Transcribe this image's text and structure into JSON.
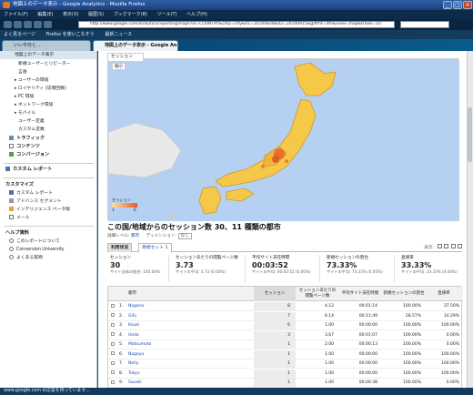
{
  "window": {
    "title": "地図上のデータ表示 - Google Analytics - Mozilla Firefox"
  },
  "menu": [
    "ファイル(F)",
    "編集(E)",
    "表示(V)",
    "履歴(S)",
    "ブックマーク(B)",
    "ツール(T)",
    "ヘルプ(H)"
  ],
  "url": "http://www.google.com/analytics/reporting/maps?id=COUNTRY&cmp=city&d1=20100828&d2=20100915&gdfmt=nth&view=map&trows=10",
  "bookmarks": [
    "よく見るページ",
    "Firefox を使いこなそう",
    "最新ニュース"
  ],
  "tabs": [
    "いい今日と...",
    "地図上のデータ表示 - Google An..."
  ],
  "sidebar": {
    "items": [
      {
        "label": "地図上のデータ表示",
        "type": "selected"
      },
      {
        "label": "新規ユーザーとリピーター",
        "type": "sub"
      },
      {
        "label": "言語",
        "type": "sub"
      },
      {
        "label": "▸ ユーザーの環境",
        "type": "sub"
      },
      {
        "label": "▸ ロイヤリティ (訪問回数)",
        "type": "sub"
      },
      {
        "label": "▸ PC 環境",
        "type": "sub"
      },
      {
        "label": "▸ ネットワーク環境",
        "type": "sub"
      },
      {
        "label": "▸ モバイル",
        "type": "sub"
      },
      {
        "label": "ユーザー定義",
        "type": "sub"
      },
      {
        "label": "カスタム変数",
        "type": "sub"
      },
      {
        "label": "トラフィック",
        "type": "head"
      },
      {
        "label": "コンテンツ",
        "type": "head"
      },
      {
        "label": "コンバージョン",
        "type": "head"
      }
    ],
    "custom_report": "カスタム レポート",
    "customize_title": "カスタマイズ",
    "customize_items": [
      "カスタム レポート",
      "アドバンス セグメント",
      "インテリジェンス ベータ版",
      "メール"
    ],
    "help_title": "ヘルプ資料",
    "help_items": [
      "このレポートについて",
      "Conversion University",
      "よくある質問"
    ]
  },
  "main": {
    "map_tab": "セッション",
    "map_zoom": "縮小",
    "legend_min": "1",
    "legend_max": "6",
    "legend_title": "セッション",
    "heading": "この国/地域からのセッション数 30、11 種類の都市",
    "detail_label": "詳細レベル:",
    "detail_value": "都市",
    "segment_label": "ディメンション:",
    "segment_value": "なし",
    "view_tabs": [
      "利用状況",
      "目標セット 1"
    ],
    "display_label": "表示:"
  },
  "summary": [
    {
      "label": "セッション",
      "value": "30",
      "sub": "サイト全体の割合: 100.00%"
    },
    {
      "label": "セッションあたりの閲覧ページ数",
      "value": "3.73",
      "sub": "サイトの平均: 3.73 (0.00%)"
    },
    {
      "label": "平均サイト滞在時間",
      "value": "00:03:52",
      "sub": "サイトの平均: 00:03:52 (0.00%)"
    },
    {
      "label": "新規セッションの割合",
      "value": "73.33%",
      "sub": "サイトの平均: 73.33% (0.00%)"
    },
    {
      "label": "直帰率",
      "value": "33.33%",
      "sub": "サイトの平均: 33.33% (0.00%)"
    }
  ],
  "table": {
    "columns": [
      "都市",
      "セッション",
      "セッションあたりの閲覧ページ数",
      "平均サイト滞在時間",
      "新規セッションの割合",
      "直帰率"
    ],
    "rows": [
      {
        "n": "1.",
        "city": "Nagano",
        "sessions": "8",
        "pages": "4.12",
        "time": "00:01:14",
        "new": "100.00%",
        "bounce": "37.50%"
      },
      {
        "n": "2.",
        "city": "Gifu",
        "sessions": "7",
        "pages": "6.14",
        "time": "00:11:49",
        "new": "28.57%",
        "bounce": "14.29%"
      },
      {
        "n": "3.",
        "city": "Kouki",
        "sessions": "6",
        "pages": "1.00",
        "time": "00:00:00",
        "new": "100.00%",
        "bounce": "100.00%"
      },
      {
        "n": "4.",
        "city": "Ueda",
        "sessions": "3",
        "pages": "3.67",
        "time": "00:01:07",
        "new": "100.00%",
        "bounce": "0.00%"
      },
      {
        "n": "5.",
        "city": "Matsumoto",
        "sessions": "1",
        "pages": "2.00",
        "time": "00:00:13",
        "new": "100.00%",
        "bounce": "0.00%"
      },
      {
        "n": "6.",
        "city": "Nagoya",
        "sessions": "1",
        "pages": "1.00",
        "time": "00:00:00",
        "new": "100.00%",
        "bounce": "100.00%"
      },
      {
        "n": "7.",
        "city": "Nelly",
        "sessions": "1",
        "pages": "1.00",
        "time": "00:00:00",
        "new": "100.00%",
        "bounce": "100.00%"
      },
      {
        "n": "8.",
        "city": "Tokyo",
        "sessions": "1",
        "pages": "1.00",
        "time": "00:00:00",
        "new": "100.00%",
        "bounce": "100.00%"
      },
      {
        "n": "9.",
        "city": "Sasaki",
        "sessions": "1",
        "pages": "1.00",
        "time": "00:00:38",
        "new": "100.00%",
        "bounce": "0.00%"
      }
    ]
  },
  "status": "www.google.com の応答を待っています..."
}
